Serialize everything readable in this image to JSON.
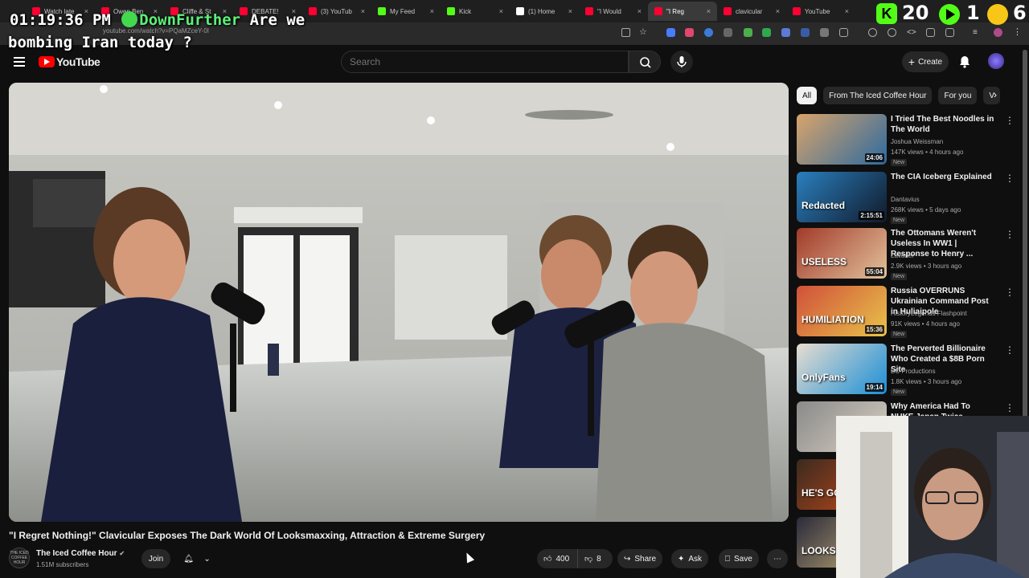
{
  "browser": {
    "tabs": [
      {
        "title": "Watch late",
        "color": "#ff0033"
      },
      {
        "title": "Owen Ben",
        "color": "#ff0033"
      },
      {
        "title": "Cliffe & St",
        "color": "#ff0033"
      },
      {
        "title": "DEBATE!",
        "color": "#ff0033"
      },
      {
        "title": "(3) YouTub",
        "color": "#ff0033"
      },
      {
        "title": "My Feed",
        "color": "#53fc18"
      },
      {
        "title": "Kick",
        "color": "#53fc18"
      },
      {
        "title": "(1) Home",
        "color": "#ffffff"
      },
      {
        "title": "\"I Would",
        "color": "#ff0033"
      },
      {
        "title": "\"I Reg",
        "color": "#ff0033"
      },
      {
        "title": "clavicular",
        "color": "#ff0033"
      },
      {
        "title": "YouTube",
        "color": "#ff0033"
      }
    ],
    "url": "youtube.com/watch?v=PQaMZceY-0I"
  },
  "stream_overlay": {
    "time": "01:19:36 PM",
    "user": "DownFurther",
    "message_line1": "Are we",
    "message_line2": "bombing Iran today ?",
    "kick_letter": "K",
    "count_a": "20",
    "count_b": "1",
    "count_c": "6"
  },
  "header": {
    "logo": "YouTube",
    "search_placeholder": "Search",
    "create_label": "Create"
  },
  "video": {
    "title": "\"I Regret Nothing!\" Clavicular Exposes The Dark World Of Looksmaxxing, Attraction & Extreme Surgery",
    "channel": "The Iced Coffee Hour",
    "channel_avatar_text": "THE ICED COFFEE HOUR",
    "subscribers": "1.51M subscribers",
    "join": "Join",
    "likes": "400",
    "dislikes": "8",
    "share": "Share",
    "ask": "Ask",
    "save": "Save"
  },
  "chips": [
    "All",
    "From The Iced Coffee Hour",
    "For you",
    "V"
  ],
  "recommendations": [
    {
      "title": "I Tried The Best Noodles in The World",
      "channel": "Joshua Weissman",
      "meta": "147K views • 4 hours ago",
      "badge": "New",
      "duration": "24:06",
      "colors": [
        "#d9a46b",
        "#2d6a9f"
      ]
    },
    {
      "title": "The CIA Iceberg Explained",
      "channel": "Dantavius",
      "meta": "268K views • 5 days ago",
      "badge": "New",
      "duration": "2:15:51",
      "colors": [
        "#2a7fbf",
        "#111a2a"
      ],
      "overlay": "Redacted"
    },
    {
      "title": "The Ottomans Weren't Useless In WW1 | Response to Henry ...",
      "channel": "Lavader",
      "meta": "2.9K views • 3 hours ago",
      "badge": "New",
      "duration": "55:04",
      "colors": [
        "#a23a2a",
        "#e2c29b"
      ],
      "overlay": "USELESS"
    },
    {
      "title": "Russia OVERRUNS Ukrainian Command Post in Huliaipole",
      "channel": "HistoryLegends Flashpoint",
      "meta": "91K views • 4 hours ago",
      "badge": "New",
      "duration": "15:36",
      "colors": [
        "#d0503a",
        "#e9c34a"
      ],
      "overlay": "HUMILIATION"
    },
    {
      "title": "The Perverted Billionaire Who Created a $8B Porn Site",
      "channel": "BC Productions",
      "meta": "1.8K views • 3 hours ago",
      "badge": "New",
      "duration": "19:14",
      "colors": [
        "#e8ddd0",
        "#1a8fd6"
      ],
      "overlay": "OnlyFans"
    },
    {
      "title": "Why America Had To NUKE Japan Twice (Explained)",
      "channel": "",
      "meta": "",
      "badge": "",
      "duration": "",
      "colors": [
        "#8a8a8a",
        "#d9d0c2"
      ]
    },
    {
      "title": "",
      "channel": "",
      "meta": "",
      "badge": "",
      "duration": "",
      "colors": [
        "#3b2a1f",
        "#c94b1a"
      ],
      "overlay": "HE'S GOIN"
    },
    {
      "title": "",
      "channel": "",
      "meta": "",
      "badge": "",
      "duration": "",
      "colors": [
        "#2a2a3a",
        "#c9b27a"
      ],
      "overlay": "LOOKS"
    }
  ]
}
